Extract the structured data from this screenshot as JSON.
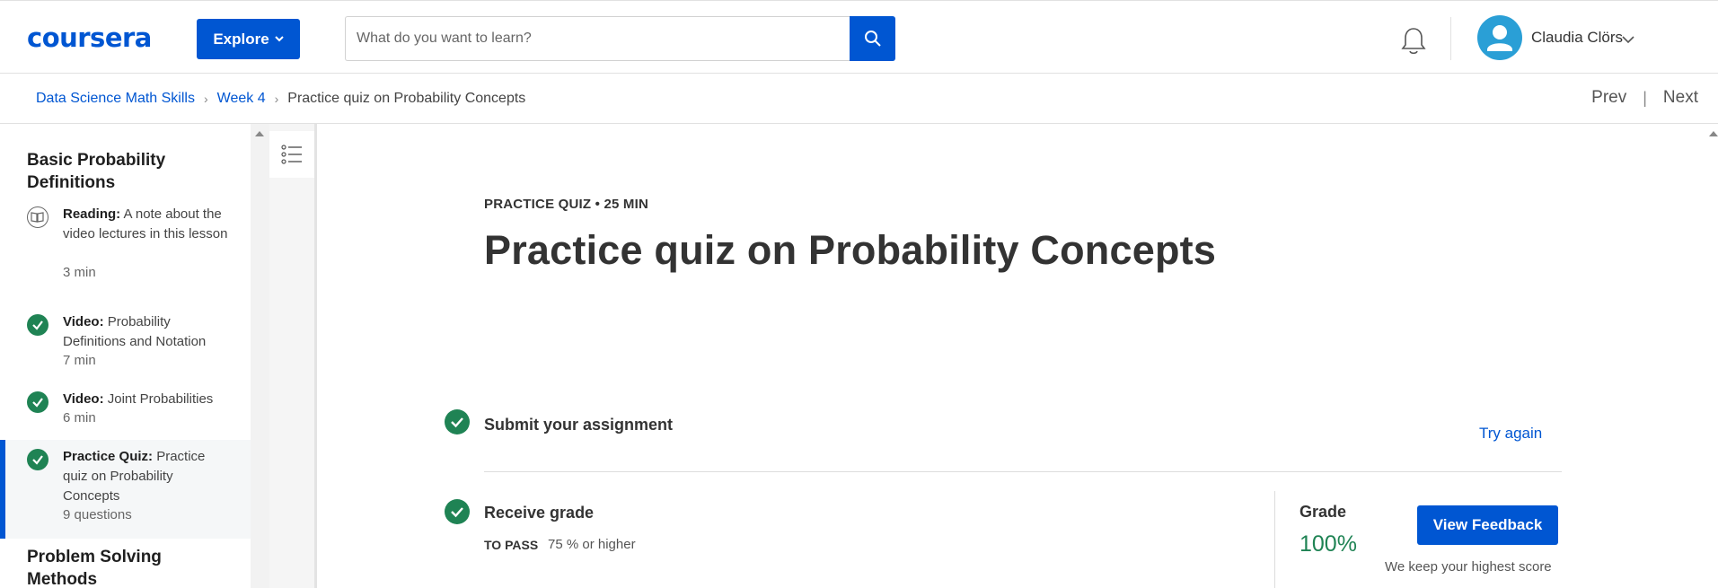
{
  "header": {
    "logo": "coursera",
    "explore_label": "Explore",
    "search_placeholder": "What do you want to learn?",
    "user_name": "Claudia Clörs"
  },
  "breadcrumb": {
    "items": [
      "Data Science Math Skills",
      "Week 4"
    ],
    "current": "Practice quiz on Probability Concepts"
  },
  "nav": {
    "prev": "Prev",
    "next": "Next"
  },
  "sidebar": {
    "section_title": "Basic Probability Definitions",
    "items": [
      {
        "type": "Reading:",
        "title": "A note about the video lectures in this lesson",
        "meta": "3 min",
        "status": "reading"
      },
      {
        "type": "Video:",
        "title": "Probability Definitions and Notation",
        "meta": "7 min",
        "status": "complete"
      },
      {
        "type": "Video:",
        "title": "Joint Probabilities",
        "meta": "6 min",
        "status": "complete"
      },
      {
        "type": "Practice Quiz:",
        "title": "Practice quiz on Probability Concepts",
        "meta": "9 questions",
        "status": "complete"
      }
    ],
    "next_section_title": "Problem Solving Methods"
  },
  "main": {
    "eyebrow": "PRACTICE QUIZ • 25 MIN",
    "title": "Practice quiz on Probability Concepts",
    "submit": {
      "title": "Submit your assignment",
      "try_again": "Try again"
    },
    "grade": {
      "title": "Receive grade",
      "pass_label": "TO PASS",
      "pass_value": "75 % or higher",
      "grade_label": "Grade",
      "grade_value": "100%",
      "feedback_label": "View Feedback",
      "keep_note": "We keep your highest score"
    }
  },
  "colors": {
    "brand": "#0056d2",
    "success": "#1f8354"
  }
}
